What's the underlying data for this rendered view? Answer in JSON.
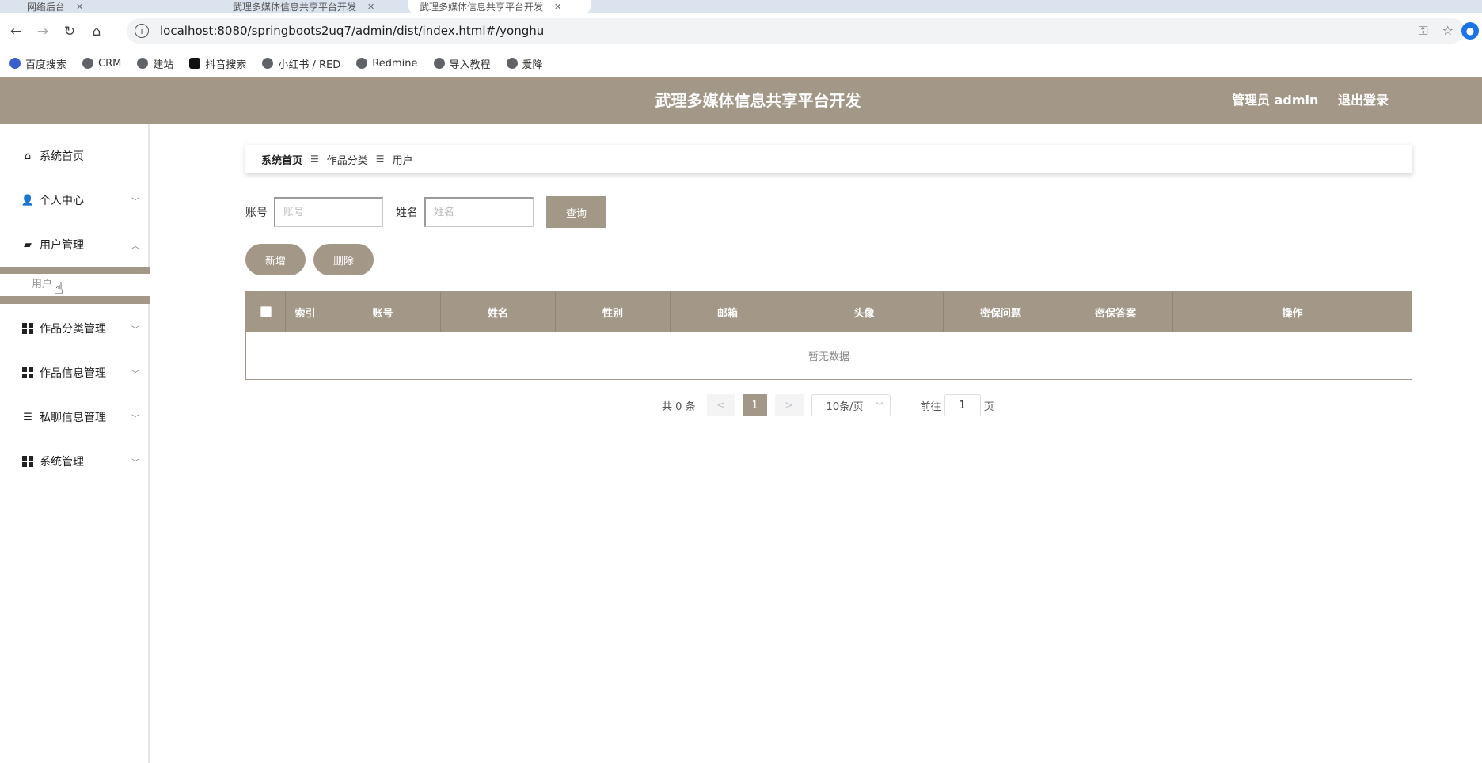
{
  "browser": {
    "tabs": [
      {
        "label": "网络后台"
      },
      {
        "label": "武理多媒体信息共享平台开发"
      },
      {
        "label": "武理多媒体信息共享平台开发"
      }
    ],
    "url": "localhost:8080/springboots2uq7/admin/dist/index.html#/yonghu",
    "bookmarks": [
      "百度搜索",
      "CRM",
      "建站",
      "抖音搜索",
      "小红书 / RED",
      "Redmine",
      "导入教程",
      "爱降"
    ]
  },
  "header": {
    "title": "武理多媒体信息共享平台开发",
    "admin_label": "管理员 admin",
    "logout_label": "退出登录"
  },
  "sidebar": {
    "items": [
      {
        "label": "系统首页"
      },
      {
        "label": "个人中心"
      },
      {
        "label": "用户管理"
      },
      {
        "label": "作品分类管理"
      },
      {
        "label": "作品信息管理"
      },
      {
        "label": "私聊信息管理"
      },
      {
        "label": "系统管理"
      }
    ],
    "sub_item": "用户"
  },
  "breadcrumb": [
    "系统首页",
    "作品分类",
    "用户"
  ],
  "search": {
    "account_label": "账号",
    "account_placeholder": "账号",
    "name_label": "姓名",
    "name_placeholder": "姓名",
    "query_label": "查询"
  },
  "actions": {
    "add_label": "新增",
    "delete_label": "删除"
  },
  "table": {
    "columns": [
      "索引",
      "账号",
      "姓名",
      "性别",
      "邮箱",
      "头像",
      "密保问题",
      "密保答案",
      "操作"
    ],
    "empty_text": "暂无数据"
  },
  "pagination": {
    "total_label": "共 0 条",
    "prev": "<",
    "current_page": "1",
    "next": ">",
    "page_size": "10条/页",
    "goto_label": "前往",
    "goto_value": "1",
    "page_suffix": "页"
  }
}
